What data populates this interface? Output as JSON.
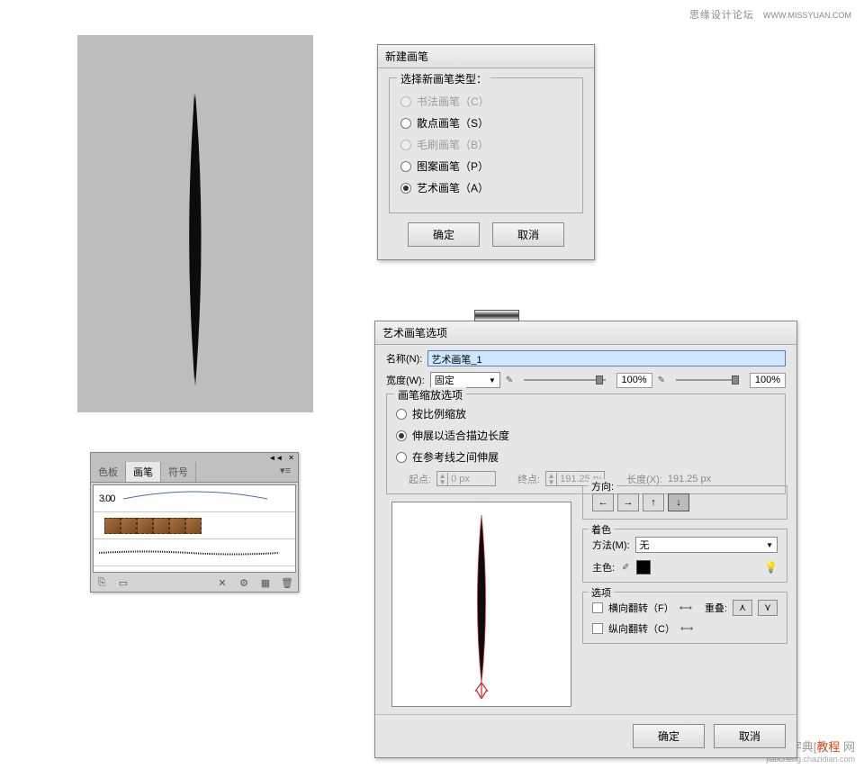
{
  "watermark": {
    "site_zh": "思缘设计论坛",
    "site_url": "WWW.MISSYUAN.COM",
    "bottom_zh_pre": "查字典",
    "bottom_zh_hl": "教程",
    "bottom_zh_post": " 网",
    "bottom_url": "jiaocheng.chazidian.com"
  },
  "newbrush": {
    "title": "新建画笔",
    "legend": "选择新画笔类型：",
    "opt_calligraphic": "书法画笔（C）",
    "opt_scatter": "散点画笔（S）",
    "opt_bristle": "毛刷画笔（B）",
    "opt_pattern": "图案画笔（P）",
    "opt_art": "艺术画笔（A）",
    "ok": "确定",
    "cancel": "取消"
  },
  "artopts": {
    "title": "艺术画笔选项",
    "name_label": "名称(N):",
    "name_value": "艺术画笔_1",
    "width_label": "宽度(W):",
    "width_mode": "固定",
    "width_pct_left": "100%",
    "width_pct_right": "100%",
    "scale_legend": "画笔缩放选项",
    "scale_proportional": "按比例缩放",
    "scale_stretch": "伸展以适合描边长度",
    "scale_between_guides": "在参考线之间伸展",
    "start_label": "起点:",
    "start_value": "0 px",
    "end_label": "终点:",
    "end_value": "191.25 px",
    "length_label": "长度(X):",
    "length_value": "191.25 px",
    "direction_legend": "方向:",
    "tint_legend": "着色",
    "method_label": "方法(M):",
    "method_value": "无",
    "keycolor_label": "主色:",
    "options_legend": "选项",
    "flip_h": "横向翻转（F）",
    "flip_v": "纵向翻转（C）",
    "overlap_label": "重叠:",
    "ok": "确定",
    "cancel": "取消"
  },
  "panel": {
    "tab_swatches": "色板",
    "tab_brushes": "画笔",
    "tab_symbols": "符号",
    "thickness": "3.00",
    "footer_icons": {
      "lib": "⎘",
      "doc": "▭",
      "del": "✕",
      "opts": "⚙",
      "new": "▦",
      "trash": "🗑"
    }
  }
}
